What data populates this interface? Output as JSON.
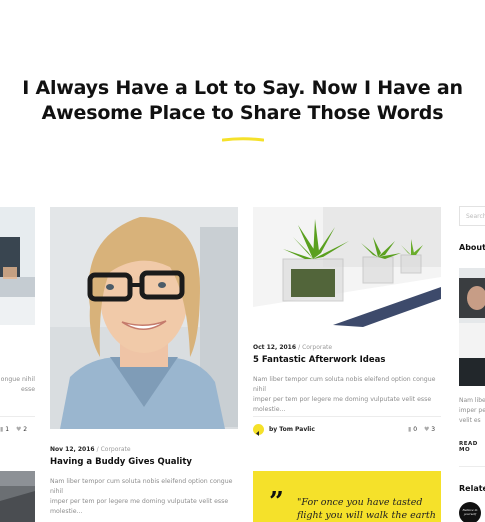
{
  "hero": {
    "title_line1": "I Always Have a Lot to Say. Now I Have an",
    "title_line2": "Awesome Place to Share Those Words",
    "accent_color": "#f5e12a"
  },
  "left_card": {
    "excerpt_lines": [
      "ongue nihil",
      "esse"
    ],
    "comments": "1",
    "likes": "2"
  },
  "card_buddy": {
    "date": "Nov 12, 2016",
    "category": "Corporate",
    "title": "Having a Buddy Gives Quality",
    "excerpt_lines": [
      "Nam liber tempor cum soluta nobis eleifend option congue nihil",
      "imper per tem por legere me doming vulputate velit esse",
      "molestie..."
    ]
  },
  "card_afterwork": {
    "date": "Oct 12, 2016",
    "category": "Corporate",
    "title": "5 Fantastic Afterwork Ideas",
    "excerpt_lines": [
      "Nam liber tempor cum soluta nobis eleifend option congue nihil",
      "imper per tem por legere me doming vulputate velit esse",
      "molestie..."
    ],
    "author": "by Tom Pavlic",
    "comments": "0",
    "likes": "3"
  },
  "quote": {
    "mark": "”",
    "text_line1": "\"For once you have tasted",
    "text_line2": "flight you will walk the earth"
  },
  "sidebar": {
    "search_placeholder": "Search",
    "about_heading": "About",
    "about_text_lines": [
      "Nam liber",
      "imper pe",
      "velit es"
    ],
    "read_more": "READ MO",
    "related_heading": "Relate",
    "badge_text": "Believe in yourself"
  }
}
